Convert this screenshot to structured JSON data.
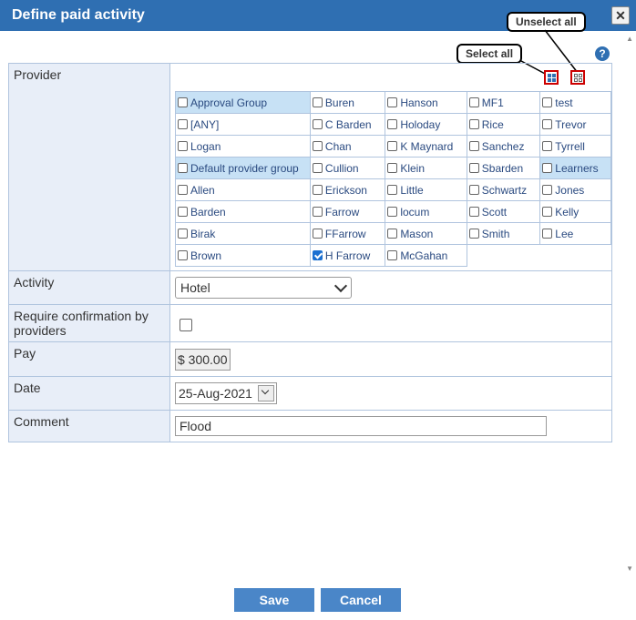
{
  "dialog": {
    "title": "Define paid activity",
    "close_symbol": "✕",
    "help_symbol": "?"
  },
  "callouts": {
    "select_all": "Select all",
    "unselect_all": "Unselect all"
  },
  "provider": {
    "label": "Provider",
    "rows": [
      [
        {
          "name": "Approval Group",
          "checked": false,
          "highlight": true
        },
        {
          "name": "Buren",
          "checked": false
        },
        {
          "name": "Hanson",
          "checked": false
        },
        {
          "name": "MF1",
          "checked": false
        },
        {
          "name": "test",
          "checked": false
        }
      ],
      [
        {
          "name": "[ANY]",
          "checked": false
        },
        {
          "name": "C Barden",
          "checked": false
        },
        {
          "name": "Holoday",
          "checked": false
        },
        {
          "name": "Rice",
          "checked": false
        },
        {
          "name": "Trevor",
          "checked": false
        }
      ],
      [
        {
          "name": "Logan",
          "checked": false
        },
        {
          "name": "Chan",
          "checked": false
        },
        {
          "name": "K Maynard",
          "checked": false
        },
        {
          "name": "Sanchez",
          "checked": false
        },
        {
          "name": "Tyrrell",
          "checked": false
        }
      ],
      [
        {
          "name": "Default provider group",
          "checked": false,
          "highlight": true
        },
        {
          "name": "Cullion",
          "checked": false
        },
        {
          "name": "Klein",
          "checked": false
        },
        {
          "name": "Sbarden",
          "checked": false
        },
        {
          "name": "Learners",
          "checked": false,
          "highlight": true
        }
      ],
      [
        {
          "name": "Allen",
          "checked": false
        },
        {
          "name": "Erickson",
          "checked": false
        },
        {
          "name": "Little",
          "checked": false
        },
        {
          "name": "Schwartz",
          "checked": false
        },
        {
          "name": "Jones",
          "checked": false
        }
      ],
      [
        {
          "name": "Barden",
          "checked": false
        },
        {
          "name": "Farrow",
          "checked": false
        },
        {
          "name": "locum",
          "checked": false
        },
        {
          "name": "Scott",
          "checked": false
        },
        {
          "name": "Kelly",
          "checked": false
        }
      ],
      [
        {
          "name": "Birak",
          "checked": false
        },
        {
          "name": "FFarrow",
          "checked": false
        },
        {
          "name": "Mason",
          "checked": false
        },
        {
          "name": "Smith",
          "checked": false
        },
        {
          "name": "Lee",
          "checked": false
        }
      ],
      [
        {
          "name": "Brown",
          "checked": false
        },
        {
          "name": "H Farrow",
          "checked": true
        },
        {
          "name": "McGahan",
          "checked": false
        }
      ]
    ]
  },
  "activity": {
    "label": "Activity",
    "value": "Hotel"
  },
  "confirmation": {
    "label": "Require confirmation by providers",
    "checked": false
  },
  "pay": {
    "label": "Pay",
    "value": "$ 300.00"
  },
  "date": {
    "label": "Date",
    "value": "25-Aug-2021"
  },
  "comment": {
    "label": "Comment",
    "value": "Flood"
  },
  "buttons": {
    "save": "Save",
    "cancel": "Cancel"
  },
  "colors": {
    "titlebar": "#2f6fb2",
    "button": "#4a86c8",
    "highlight": "#c7e1f5",
    "label_bg": "#e8eef8"
  }
}
